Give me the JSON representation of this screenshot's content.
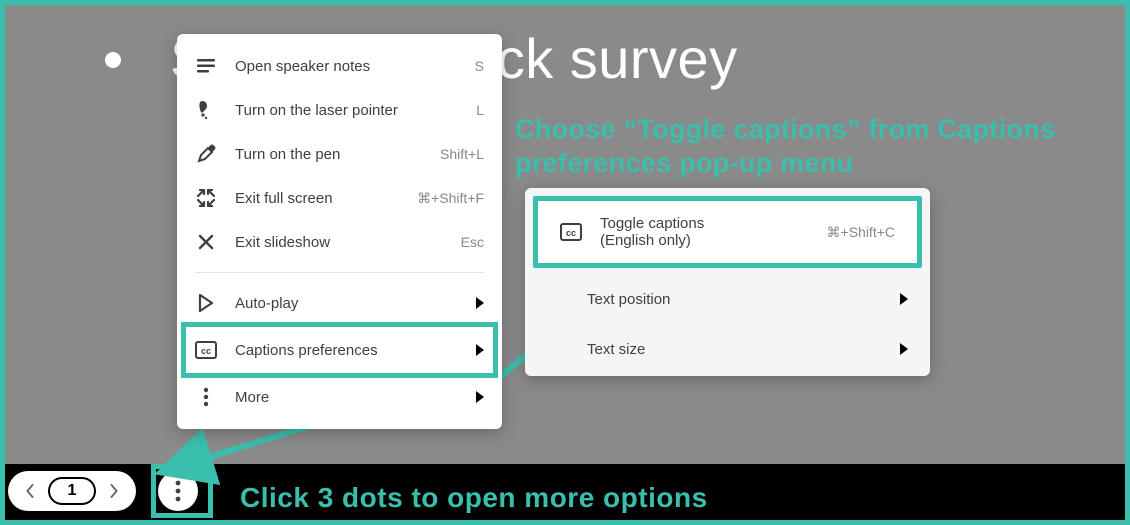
{
  "slide": {
    "title": "Short feedback survey"
  },
  "nav": {
    "current": "1"
  },
  "menu1": {
    "items": [
      {
        "label": "Open speaker notes",
        "short": "S",
        "icon": "notes"
      },
      {
        "label": "Turn on the laser pointer",
        "short": "L",
        "icon": "laser"
      },
      {
        "label": "Turn on the pen",
        "short": "Shift+L",
        "icon": "pen"
      },
      {
        "label": "Exit full screen",
        "short": "⌘+Shift+F",
        "icon": "collapse"
      },
      {
        "label": "Exit slideshow",
        "short": "Esc",
        "icon": "close"
      }
    ],
    "submenus": [
      {
        "label": "Auto-play",
        "icon": "play"
      },
      {
        "label": "Captions preferences",
        "icon": "cc"
      },
      {
        "label": "More",
        "icon": "more-v"
      }
    ]
  },
  "menu2": {
    "toggle": {
      "label": "Toggle captions",
      "subtitle": "(English only)",
      "short": "⌘+Shift+C"
    },
    "items": [
      {
        "label": "Text position"
      },
      {
        "label": "Text size"
      }
    ]
  },
  "instructions": {
    "top": "Choose “Toggle captions” from Captions preferences pop-up menu",
    "bottom": "Click 3 dots to open more options"
  }
}
